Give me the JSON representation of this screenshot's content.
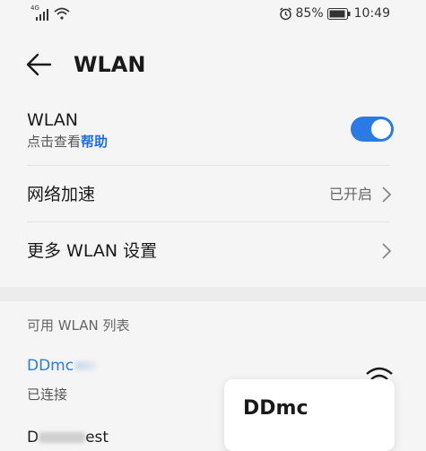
{
  "status_bar": {
    "signal_label": "4G",
    "battery": "85%",
    "time": "10:49"
  },
  "header": {
    "title": "WLAN"
  },
  "wlan_row": {
    "label": "WLAN",
    "hint_prefix": "点击查看",
    "hint_link": "帮助",
    "toggle_on": true
  },
  "accel_row": {
    "label": "网络加速",
    "value": "已开启"
  },
  "more_row": {
    "label": "更多 WLAN 设置"
  },
  "list_section": {
    "title": "可用 WLAN 列表"
  },
  "networks": [
    {
      "name_visible": "DDmc",
      "status": "已连接"
    },
    {
      "name_visible_start": "D",
      "name_visible_end": "est"
    }
  ],
  "popup": {
    "title": "DDmc"
  },
  "colors": {
    "accent": "#2b7be6",
    "link": "#1e6fdc",
    "background": "#f5f5f5"
  }
}
